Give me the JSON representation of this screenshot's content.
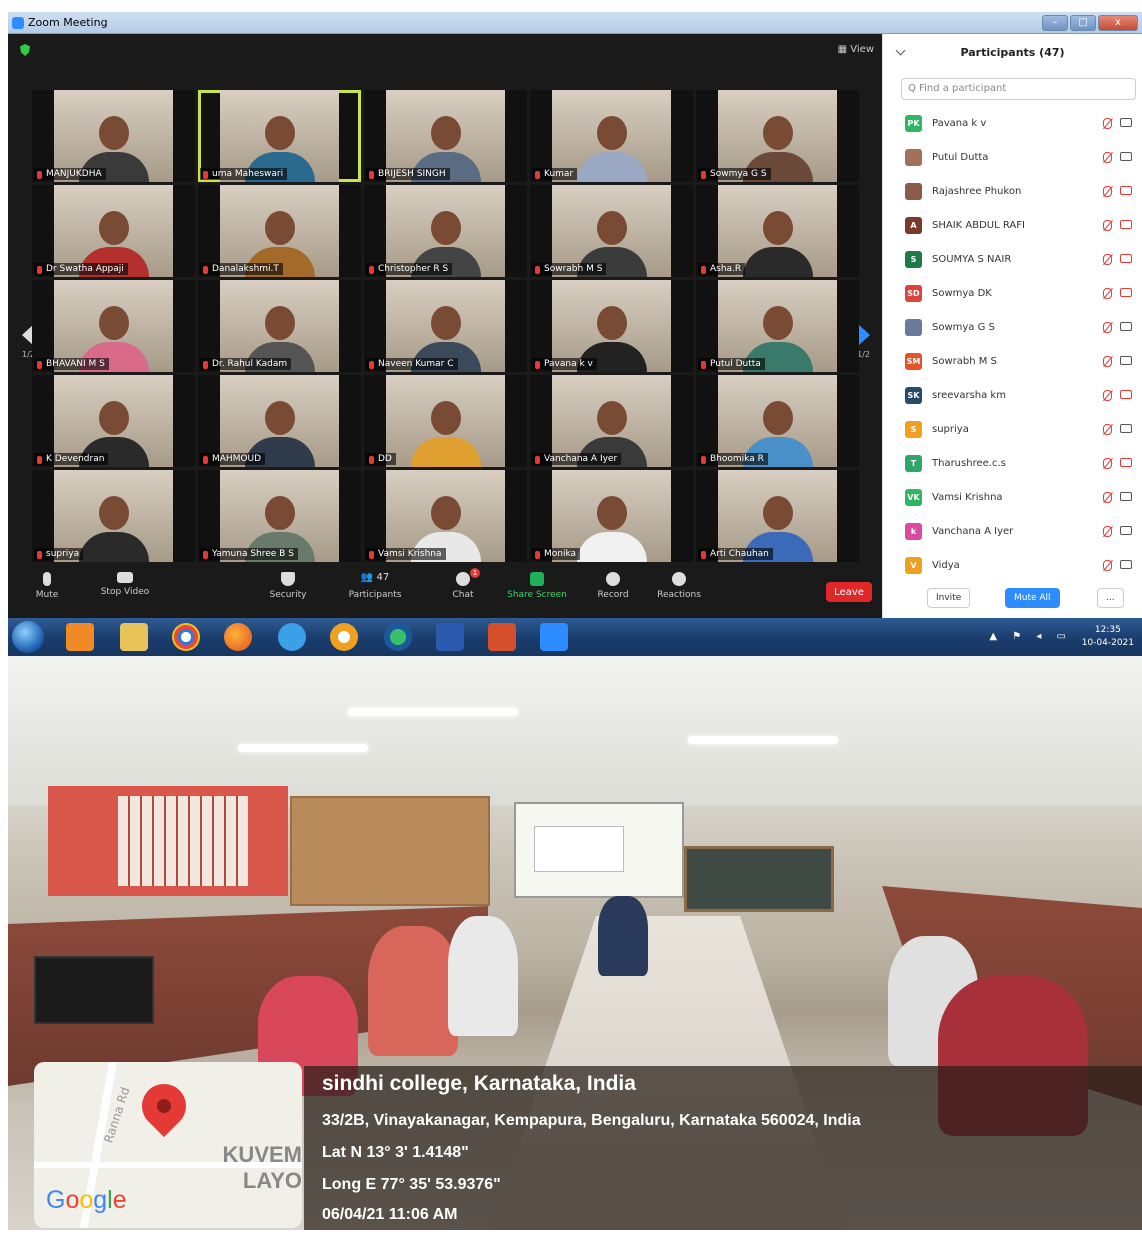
{
  "window": {
    "title": "Zoom Meeting",
    "buttons": [
      "–",
      "□",
      "x"
    ]
  },
  "meeting": {
    "view_label": "View",
    "page_indicator": "1/2",
    "tiles": [
      {
        "name": "MANJUKDHA",
        "shirt": "#3a3a3a",
        "active": false
      },
      {
        "name": "uma Maheswari",
        "shirt": "#2b6a8f",
        "active": true
      },
      {
        "name": "BRIJESH SINGH",
        "shirt": "#5b6b82",
        "active": false
      },
      {
        "name": "Kumar",
        "shirt": "#9aa8c4",
        "active": false
      },
      {
        "name": "Sowmya G S",
        "shirt": "#6b4a3a",
        "active": false
      },
      {
        "name": "Dr Swatha Appaji",
        "shirt": "#b3302f",
        "active": false
      },
      {
        "name": "Danalakshmi.T",
        "shirt": "#a36a2a",
        "active": false
      },
      {
        "name": "Christopher R S",
        "shirt": "#444",
        "active": false
      },
      {
        "name": "Sowrabh M S",
        "shirt": "#3b3b3b",
        "active": false
      },
      {
        "name": "Asha.R",
        "shirt": "#2a2a2a",
        "active": false
      },
      {
        "name": "BHAVANI M S",
        "shirt": "#d96a8a",
        "active": false
      },
      {
        "name": "Dr. Rahul Kadam",
        "shirt": "#555",
        "active": false
      },
      {
        "name": "Naveen Kumar C",
        "shirt": "#3a4a5a",
        "active": false
      },
      {
        "name": "Pavana k v",
        "shirt": "#222",
        "active": false
      },
      {
        "name": "Putul Dutta",
        "shirt": "#3a7a6a",
        "active": false
      },
      {
        "name": "K Devendran",
        "shirt": "#2a2a2a",
        "active": false
      },
      {
        "name": "MAHMOUD",
        "shirt": "#2f3a4a",
        "active": false
      },
      {
        "name": "DD",
        "shirt": "#e0a030",
        "active": false
      },
      {
        "name": "Vanchana A Iyer",
        "shirt": "#3a3a3a",
        "active": false
      },
      {
        "name": "Bhoomika R",
        "shirt": "#4a90c8",
        "active": false
      },
      {
        "name": "supriya",
        "shirt": "#2a2a2a",
        "active": false
      },
      {
        "name": "Yamuna Shree B S",
        "shirt": "#6a7a6a",
        "active": false
      },
      {
        "name": "Vamsi Krishna",
        "shirt": "#e8e8e8",
        "active": false
      },
      {
        "name": "Monika",
        "shirt": "#f0f0f0",
        "active": false
      },
      {
        "name": "Arti Chauhan",
        "shirt": "#3a6ab8",
        "active": false
      }
    ],
    "toolbar": {
      "mute": "Mute",
      "stop_video": "Stop Video",
      "security": "Security",
      "participants": "Participants",
      "participant_count": "47",
      "chat": "Chat",
      "chat_badge": "1",
      "share_screen": "Share Screen",
      "record": "Record",
      "reactions": "Reactions",
      "leave": "Leave"
    }
  },
  "participants_panel": {
    "title": "Participants (47)",
    "search_placeholder": "Q Find a participant",
    "items": [
      {
        "initials": "PK",
        "color": "#2fb564",
        "name": "Pavana k v",
        "video_off": false
      },
      {
        "initials": "",
        "color": "#a5705a",
        "name": "Putul Dutta",
        "video_off": false
      },
      {
        "initials": "",
        "color": "#8a5a4a",
        "name": "Rajashree Phukon",
        "video_off": true
      },
      {
        "initials": "A",
        "color": "#7a3a2a",
        "name": "SHAIK ABDUL RAFI",
        "video_off": true
      },
      {
        "initials": "S",
        "color": "#1f7a4a",
        "name": "SOUMYA S NAIR",
        "video_off": true
      },
      {
        "initials": "SD",
        "color": "#d9453a",
        "name": "Sowmya DK",
        "video_off": true
      },
      {
        "initials": "",
        "color": "#6a7a9a",
        "name": "Sowmya G S",
        "video_off": false
      },
      {
        "initials": "SM",
        "color": "#e0562a",
        "name": "Sowrabh M S",
        "video_off": false
      },
      {
        "initials": "SK",
        "color": "#2a4a6a",
        "name": "sreevarsha km",
        "video_off": true
      },
      {
        "initials": "S",
        "color": "#f0a020",
        "name": "supriya",
        "video_off": false
      },
      {
        "initials": "T",
        "color": "#2fa56a",
        "name": "Tharushree.c.s",
        "video_off": true
      },
      {
        "initials": "VK",
        "color": "#2fb564",
        "name": "Vamsi Krishna",
        "video_off": false
      },
      {
        "initials": "k",
        "color": "#d94aa0",
        "name": "Vanchana A Iyer",
        "video_off": false
      },
      {
        "initials": "V",
        "color": "#f0a020",
        "name": "Vidya",
        "video_off": false
      }
    ],
    "invite": "Invite",
    "mute_all": "Mute All",
    "more": "..."
  },
  "taskbar": {
    "time": "12:35",
    "date": "10-04-2021"
  },
  "location": {
    "title": "sindhi college, Karnataka, India",
    "address": "33/2B, Vinayakanagar, Kempapura, Bengaluru, Karnataka 560024, India",
    "lat": "Lat N 13° 3' 1.4148\"",
    "long": "Long E 77° 35' 53.9376\"",
    "datetime": "06/04/21 11:06 AM",
    "map_road": "Ranna Rd",
    "map_area_1": "KUVEM",
    "map_area_2": "LAYO",
    "map_brand": "Google"
  }
}
